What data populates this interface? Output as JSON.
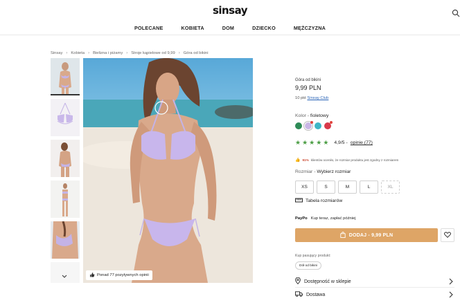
{
  "header": {
    "logo": "sinsay",
    "nav": [
      "POLECANE",
      "KOBIETA",
      "DOM",
      "DZIECKO",
      "MĘŻCZYZNA"
    ]
  },
  "breadcrumb": [
    "Sinsay",
    "Kobieta",
    "Bielizna i piżamy",
    "Stroje kąpielowe od 9,99",
    "Góra od bikini"
  ],
  "gallery": {
    "opinions_badge": "Ponad 77 pozytywnych opinii"
  },
  "product": {
    "name": "Góra od bikini",
    "price": "9,99 PLN",
    "club_prefix": "10 pkt",
    "club_link": "Sinsay Club",
    "color_label": "Kolor -",
    "color_value": "fioletowy",
    "swatches": [
      "#2e8b57",
      "#c9b6e6",
      "#3fb6c6",
      "#d93a4a"
    ],
    "rating": "4,9/5",
    "rating_sep": "-",
    "opinions_link": "opinie (77)",
    "fit_pct": "91%",
    "fit_text": "klientów oceniło, że rozmiar produktu jest zgodny z rozmiarem",
    "size_label": "Rozmiar -",
    "size_value": "Wybierz rozmiar",
    "sizes": [
      "XS",
      "S",
      "M",
      "L",
      "XL"
    ],
    "size_table": "Tabela rozmiarów",
    "paypo_logo": "PayPo",
    "paypo_text": "Kup teraz, zapłać później",
    "add_button": "DODAJ - 9,99 PLN",
    "pair_label": "Kup pasujący produkt:",
    "pair_chip": "Dół od bikini",
    "availability": "Dostępność w sklepie",
    "delivery": "Dostawa"
  },
  "colors": {
    "accent": "#dea566",
    "star": "#4a9d43",
    "link": "#2a64b7"
  }
}
